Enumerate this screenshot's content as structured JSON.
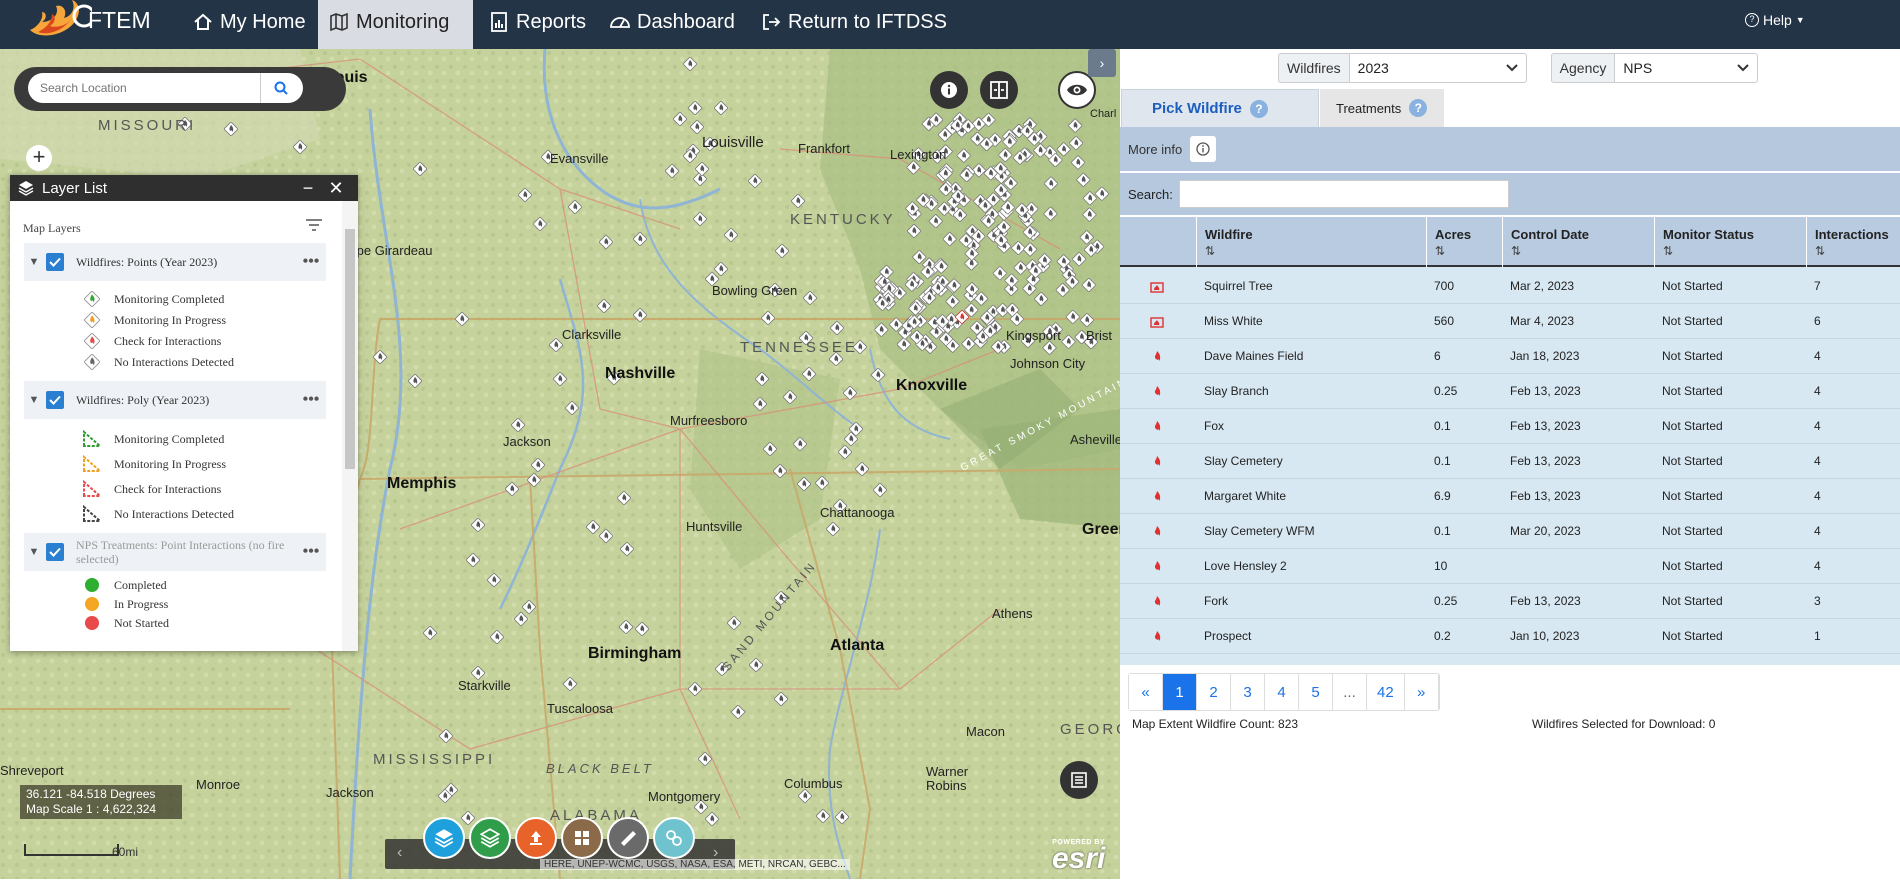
{
  "nav": {
    "brand": "FTEM",
    "items": [
      {
        "label": "My Home",
        "icon": "home-icon"
      },
      {
        "label": "Monitoring",
        "icon": "map-icon"
      },
      {
        "label": "Reports",
        "icon": "report-icon"
      },
      {
        "label": "Dashboard",
        "icon": "dashboard-icon"
      },
      {
        "label": "Return to IFTDSS",
        "icon": "exit-icon"
      }
    ],
    "help": "Help"
  },
  "map": {
    "search_placeholder": "Search Location",
    "cities": [
      {
        "name": "Louisville",
        "big": false
      },
      {
        "name": "Frankfort",
        "big": false
      },
      {
        "name": "Lexington",
        "big": false
      },
      {
        "name": "Evansville",
        "big": false
      },
      {
        "name": "Cape Girardeau",
        "big": false
      },
      {
        "name": "Bowling Green",
        "big": false
      },
      {
        "name": "Clarksville",
        "big": false
      },
      {
        "name": "Nashville",
        "big": true
      },
      {
        "name": "Murfreesboro",
        "big": false
      },
      {
        "name": "Knoxville",
        "big": true
      },
      {
        "name": "Kingsport",
        "big": false
      },
      {
        "name": "Johnson City",
        "big": false
      },
      {
        "name": "Asheville",
        "big": false
      },
      {
        "name": "Jackson",
        "big": false
      },
      {
        "name": "Memphis",
        "big": true
      },
      {
        "name": "Huntsville",
        "big": false
      },
      {
        "name": "Chattanooga",
        "big": false
      },
      {
        "name": "Birmingham",
        "big": true
      },
      {
        "name": "Tuscaloosa",
        "big": false
      },
      {
        "name": "Atlanta",
        "big": true
      },
      {
        "name": "Athens",
        "big": false
      },
      {
        "name": "Macon",
        "big": false
      },
      {
        "name": "Warner Robins",
        "big": false
      },
      {
        "name": "Columbus",
        "big": false
      },
      {
        "name": "Montgomery",
        "big": false
      },
      {
        "name": "Starkville",
        "big": false
      },
      {
        "name": "Monroe",
        "big": false
      },
      {
        "name": "Jackson",
        "big": false
      },
      {
        "name": "Shreveport",
        "big": false
      },
      {
        "name": "Green",
        "big": true
      },
      {
        "name": "Brist",
        "big": false
      },
      {
        "name": "Charl",
        "big": false
      },
      {
        "name": "St. Louis",
        "big": true
      }
    ],
    "states": [
      "MISSOURI",
      "KENTUCKY",
      "TENNESSEE",
      "MISSISSIPPI",
      "ALABAMA",
      "GEORGIA",
      "BLACK BELT",
      "SAND MOUNTAIN",
      "GREAT SMOKY MOUNTAINS"
    ],
    "layer_list": {
      "title": "Layer List",
      "map_layers_label": "Map Layers",
      "groups": [
        {
          "name": "Wildfires: Points (Year 2023)",
          "dim": false,
          "items": [
            {
              "label": "Monitoring Completed",
              "color": "#3aa53a"
            },
            {
              "label": "Monitoring In Progress",
              "color": "#f0a020"
            },
            {
              "label": "Check for Interactions",
              "color": "#e84a4a"
            },
            {
              "label": "No Interactions Detected",
              "color": "#666666"
            }
          ]
        },
        {
          "name": "Wildfires: Poly (Year 2023)",
          "dim": false,
          "items": [
            {
              "label": "Monitoring Completed",
              "color": "#2e9e2e"
            },
            {
              "label": "Monitoring In Progress",
              "color": "#f0a020"
            },
            {
              "label": "Check for Interactions",
              "color": "#e84a4a"
            },
            {
              "label": "No Interactions Detected",
              "color": "#444444"
            }
          ]
        },
        {
          "name": "NPS Treatments: Point Interactions (no fire selected)",
          "dim": true,
          "items": [
            {
              "label": "Completed",
              "color": "#2eae2e"
            },
            {
              "label": "In Progress",
              "color": "#f5a623"
            },
            {
              "label": "Not Started",
              "color": "#e84a4a"
            }
          ]
        }
      ]
    },
    "coords": "36.121 -84.518 Degrees",
    "scale": "Map Scale 1 : 4,622,324",
    "scalebar_label": "60mi",
    "attribution": "HERE, UNEP-WCMC, USGS, NASA, ESA, METI, NRCAN, GEBC...",
    "esri_powered": "POWERED BY",
    "esri_text": "esri",
    "toolbar_buttons": [
      {
        "icon": "layers-icon",
        "color": "#1ea0dc"
      },
      {
        "icon": "layer-stack-icon",
        "color": "#2f9d4a"
      },
      {
        "icon": "upload-icon",
        "color": "#e8632a"
      },
      {
        "icon": "grid-icon",
        "color": "#8b6a4a"
      },
      {
        "icon": "measure-icon",
        "color": "#6a6a6a"
      },
      {
        "icon": "analysis-icon",
        "color": "#6ec3cf"
      }
    ]
  },
  "panel": {
    "wildfires_label": "Wildfires",
    "year": "2023",
    "agency_label": "Agency",
    "agency": "NPS",
    "tab_pick": "Pick Wildfire",
    "tab_treatments": "Treatments",
    "more_info": "More info",
    "search_label": "Search:",
    "columns": [
      "Wildfire",
      "Acres",
      "Control Date",
      "Monitor Status",
      "Interactions"
    ],
    "sort_glyph": "⇅",
    "rows": [
      {
        "type": "poly",
        "wildfire": "Squirrel Tree",
        "acres": "700",
        "control_date": "Mar 2, 2023",
        "status": "Not Started",
        "interactions": "7"
      },
      {
        "type": "poly",
        "wildfire": "Miss White",
        "acres": "560",
        "control_date": "Mar 4, 2023",
        "status": "Not Started",
        "interactions": "6"
      },
      {
        "type": "point",
        "wildfire": "Dave Maines Field",
        "acres": "6",
        "control_date": "Jan 18, 2023",
        "status": "Not Started",
        "interactions": "4"
      },
      {
        "type": "point",
        "wildfire": "Slay Branch",
        "acres": "0.25",
        "control_date": "Feb 13, 2023",
        "status": "Not Started",
        "interactions": "4"
      },
      {
        "type": "point",
        "wildfire": "Fox",
        "acres": "0.1",
        "control_date": "Feb 13, 2023",
        "status": "Not Started",
        "interactions": "4"
      },
      {
        "type": "point",
        "wildfire": "Slay Cemetery",
        "acres": "0.1",
        "control_date": "Feb 13, 2023",
        "status": "Not Started",
        "interactions": "4"
      },
      {
        "type": "point",
        "wildfire": "Margaret White",
        "acres": "6.9",
        "control_date": "Feb 13, 2023",
        "status": "Not Started",
        "interactions": "4"
      },
      {
        "type": "point",
        "wildfire": "Slay Cemetery WFM",
        "acres": "0.1",
        "control_date": "Mar 20, 2023",
        "status": "Not Started",
        "interactions": "4"
      },
      {
        "type": "point",
        "wildfire": "Love Hensley 2",
        "acres": "10",
        "control_date": "",
        "status": "Not Started",
        "interactions": "4"
      },
      {
        "type": "point",
        "wildfire": "Fork",
        "acres": "0.25",
        "control_date": "Feb 13, 2023",
        "status": "Not Started",
        "interactions": "3"
      },
      {
        "type": "point",
        "wildfire": "Prospect",
        "acres": "0.2",
        "control_date": "Jan 10, 2023",
        "status": "Not Started",
        "interactions": "1"
      }
    ],
    "pagination": [
      "«",
      "1",
      "2",
      "3",
      "4",
      "5",
      "...",
      "42",
      "»"
    ],
    "active_page": "1",
    "extent_count": "Map Extent Wildfire Count: 823",
    "download_count": "Wildfires Selected for Download: 0"
  }
}
